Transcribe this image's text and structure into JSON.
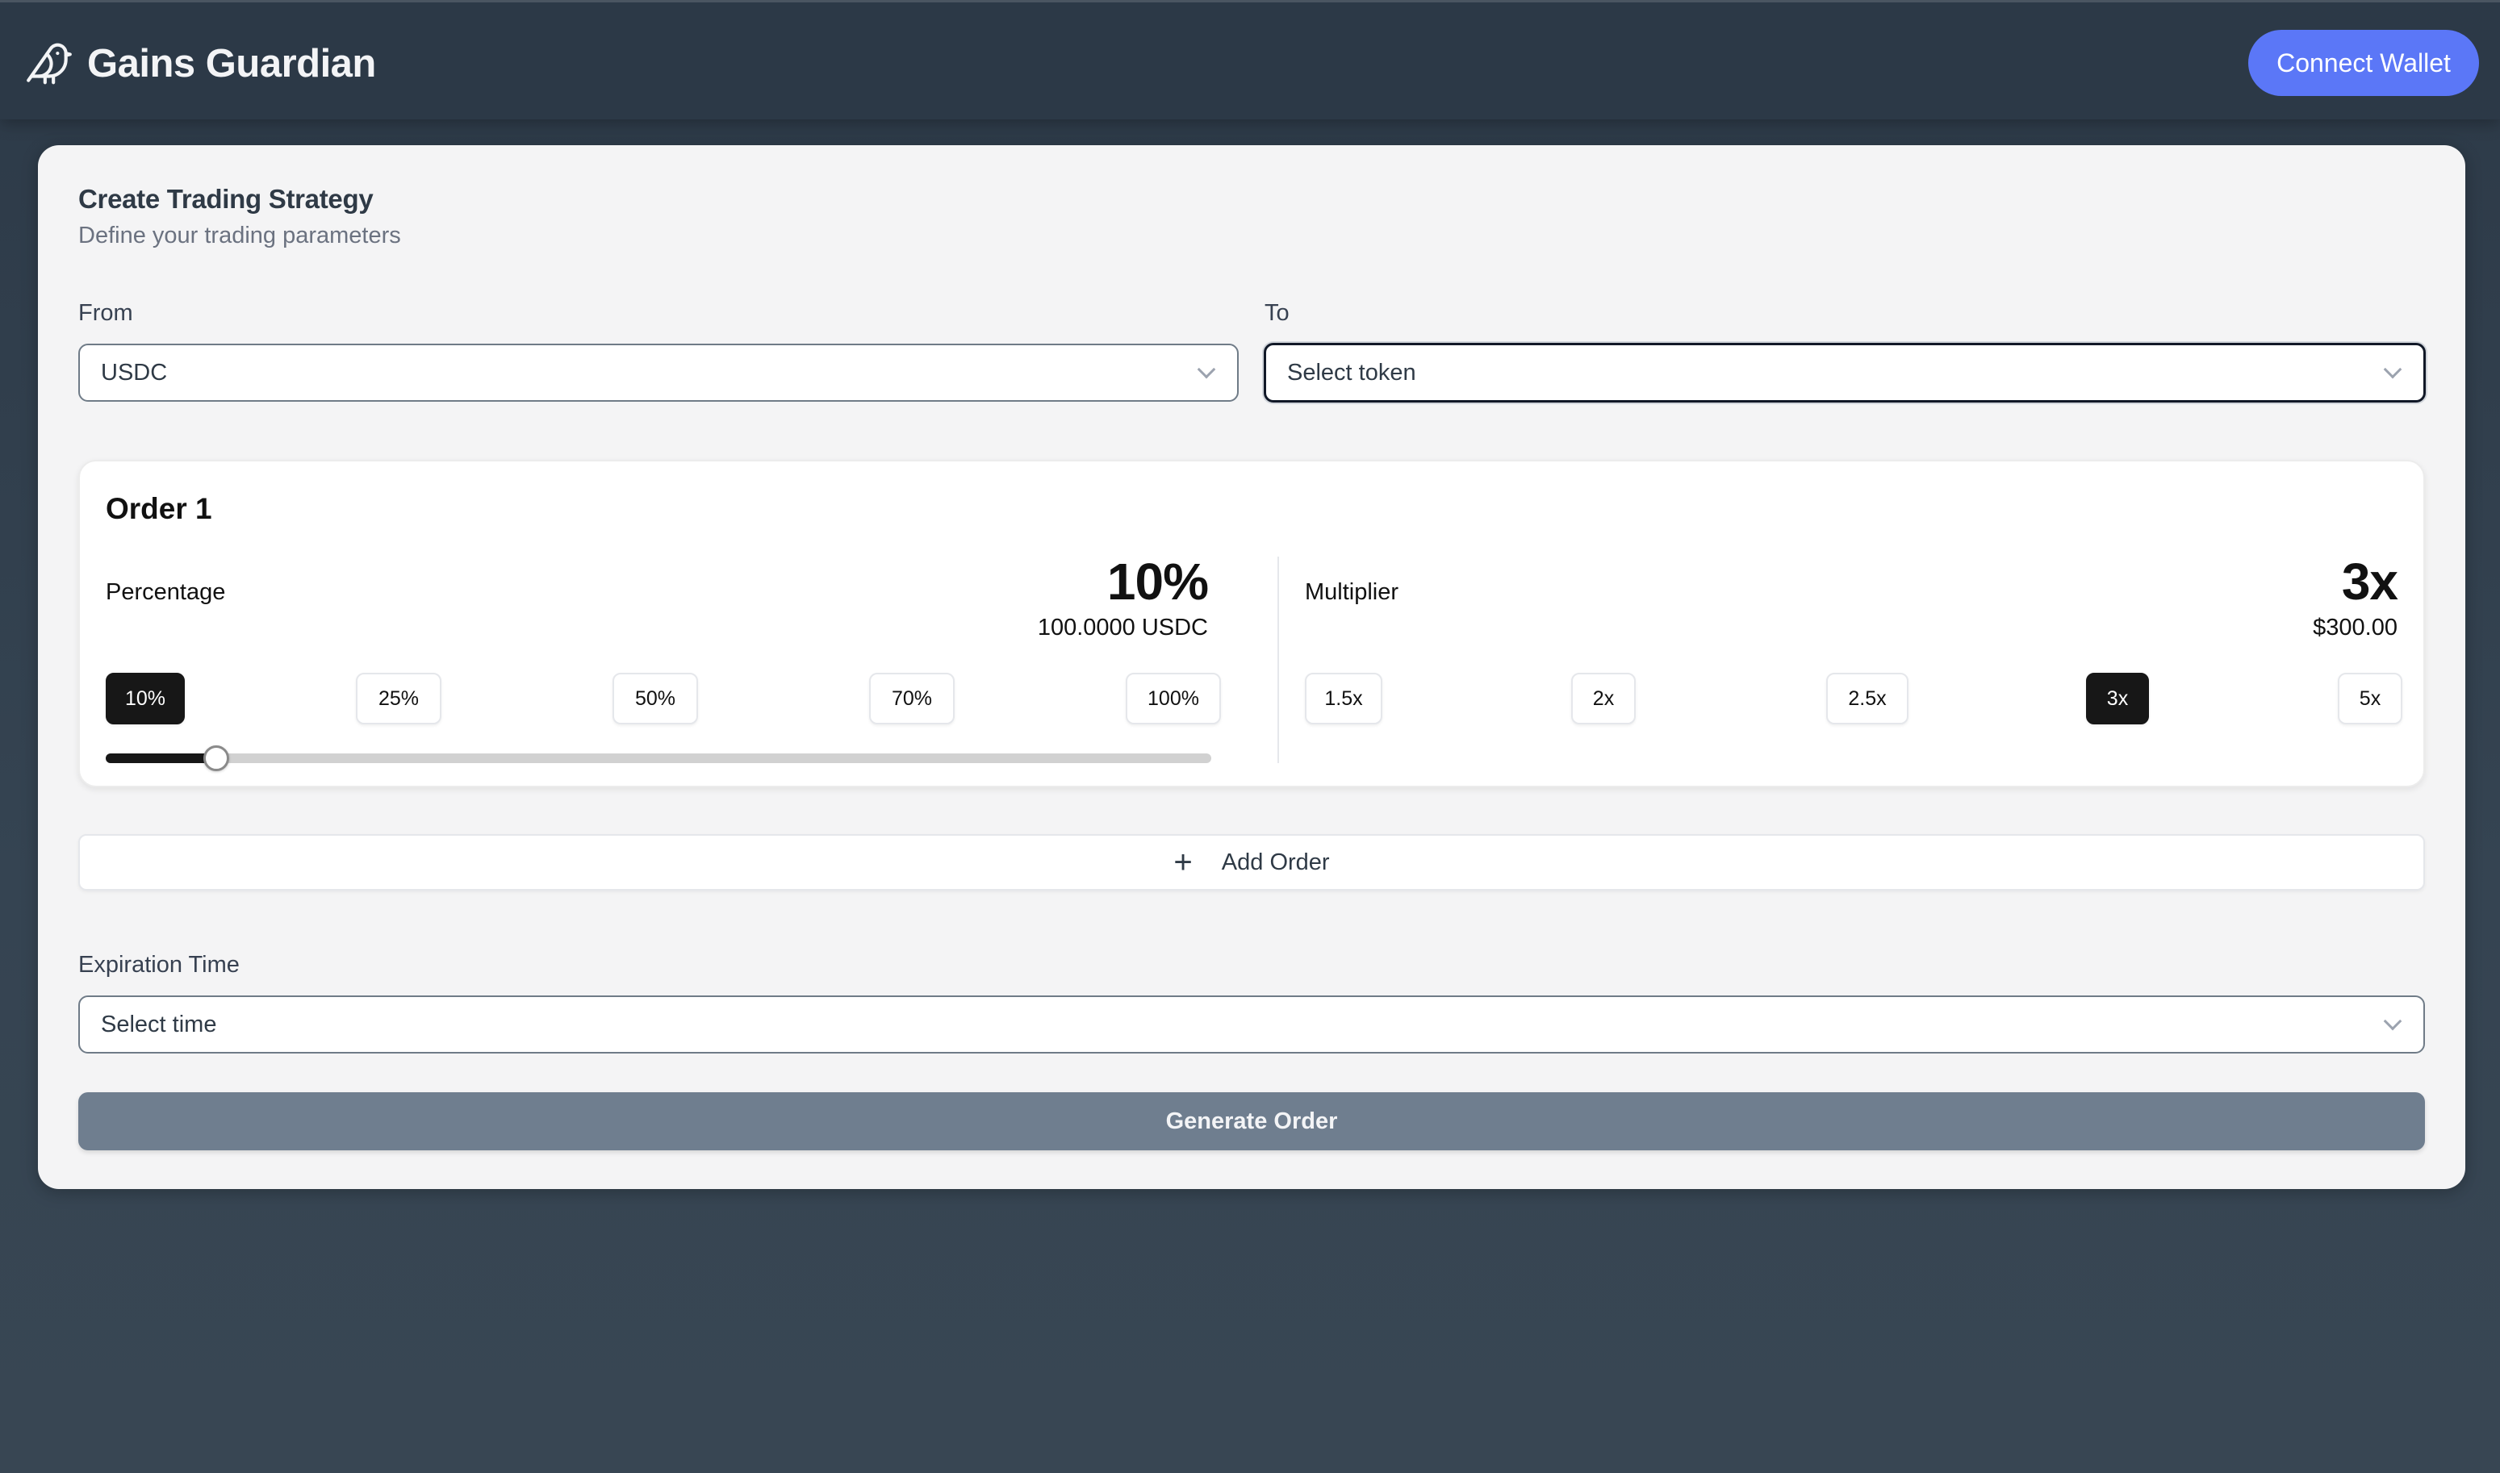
{
  "header": {
    "app_title": "Gains Guardian",
    "logo_icon": "bird-icon",
    "connect_wallet_label": "Connect Wallet",
    "accent_color": "#5b77f7"
  },
  "strategy": {
    "title": "Create Trading Strategy",
    "subtitle": "Define your trading parameters",
    "from": {
      "label": "From",
      "value": "USDC"
    },
    "to": {
      "label": "To",
      "placeholder": "Select token"
    }
  },
  "orders": [
    {
      "title": "Order 1",
      "percentage": {
        "label": "Percentage",
        "value_display": "10%",
        "amount_display": "100.0000 USDC",
        "slider_value_percent": 10,
        "options": [
          {
            "label": "10%",
            "selected": true
          },
          {
            "label": "25%",
            "selected": false
          },
          {
            "label": "50%",
            "selected": false
          },
          {
            "label": "70%",
            "selected": false
          },
          {
            "label": "100%",
            "selected": false
          }
        ]
      },
      "multiplier": {
        "label": "Multiplier",
        "value_display": "3x",
        "amount_display": "$300.00",
        "options": [
          {
            "label": "1.5x",
            "selected": false
          },
          {
            "label": "2x",
            "selected": false
          },
          {
            "label": "2.5x",
            "selected": false
          },
          {
            "label": "3x",
            "selected": true
          },
          {
            "label": "5x",
            "selected": false
          }
        ]
      }
    }
  ],
  "add_order_label": "Add Order",
  "expiration": {
    "label": "Expiration Time",
    "placeholder": "Select time"
  },
  "generate_label": "Generate Order"
}
